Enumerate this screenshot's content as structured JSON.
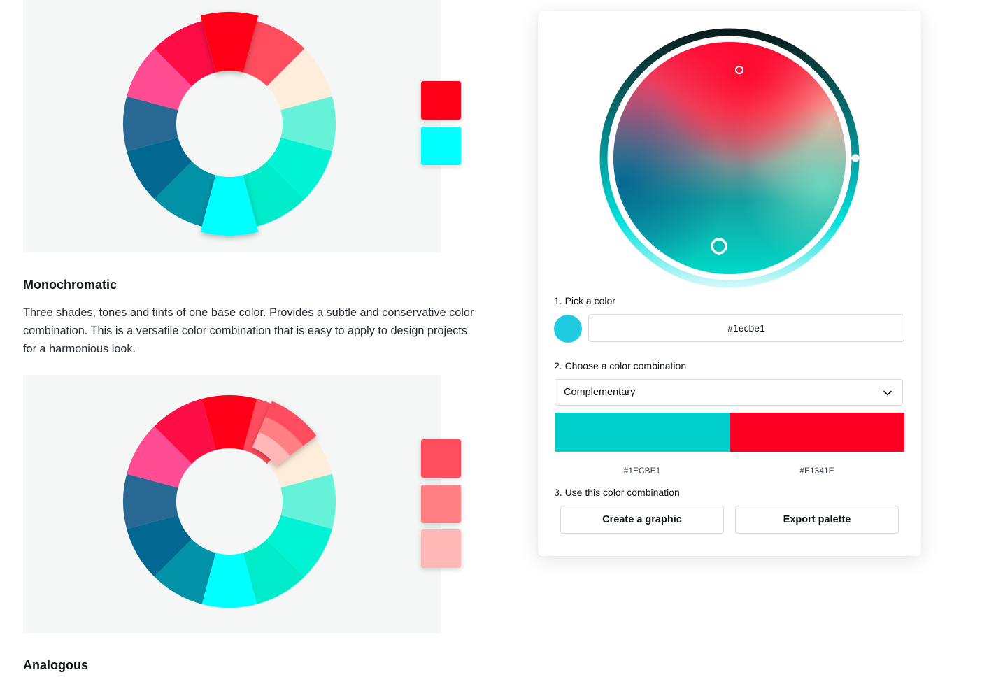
{
  "sections": {
    "monochromatic": {
      "title": "Monochromatic",
      "description": "Three shades, tones and tints of one base color. Provides a subtle and conservative color combination. This is a versatile color combination that is easy to apply to design projects for a harmonious look."
    },
    "analogous": {
      "title": "Analogous"
    }
  },
  "wheel_colors": [
    "#ff0019",
    "#ff4d5e",
    "#ffeddc",
    "#66f2d8",
    "#00f3d5",
    "#00ebca",
    "#00ffff",
    "#0292a7",
    "#026892",
    "#276993",
    "#ff4c93",
    "#fd0d45"
  ],
  "complementary_example": {
    "swatches": [
      "#ff0019",
      "#00ffff"
    ]
  },
  "monochromatic_example": {
    "swatches": [
      "#ff4d5e",
      "#ff7f82",
      "#ffb7b5"
    ]
  },
  "tool": {
    "step1_label": "1. Pick a color",
    "color_value": "#1ecbe1",
    "step2_label": "2. Choose a color combination",
    "combination_selected": "Complementary",
    "result_colors": [
      {
        "hex": "#1ECBE1",
        "color": "#00d0cb"
      },
      {
        "hex": "#E1341E",
        "color": "#ff0025"
      }
    ],
    "step3_label": "3. Use this color combination",
    "create_button": "Create a graphic",
    "export_button": "Export palette"
  },
  "icons": {
    "dropdown": "chevron-down-icon"
  }
}
